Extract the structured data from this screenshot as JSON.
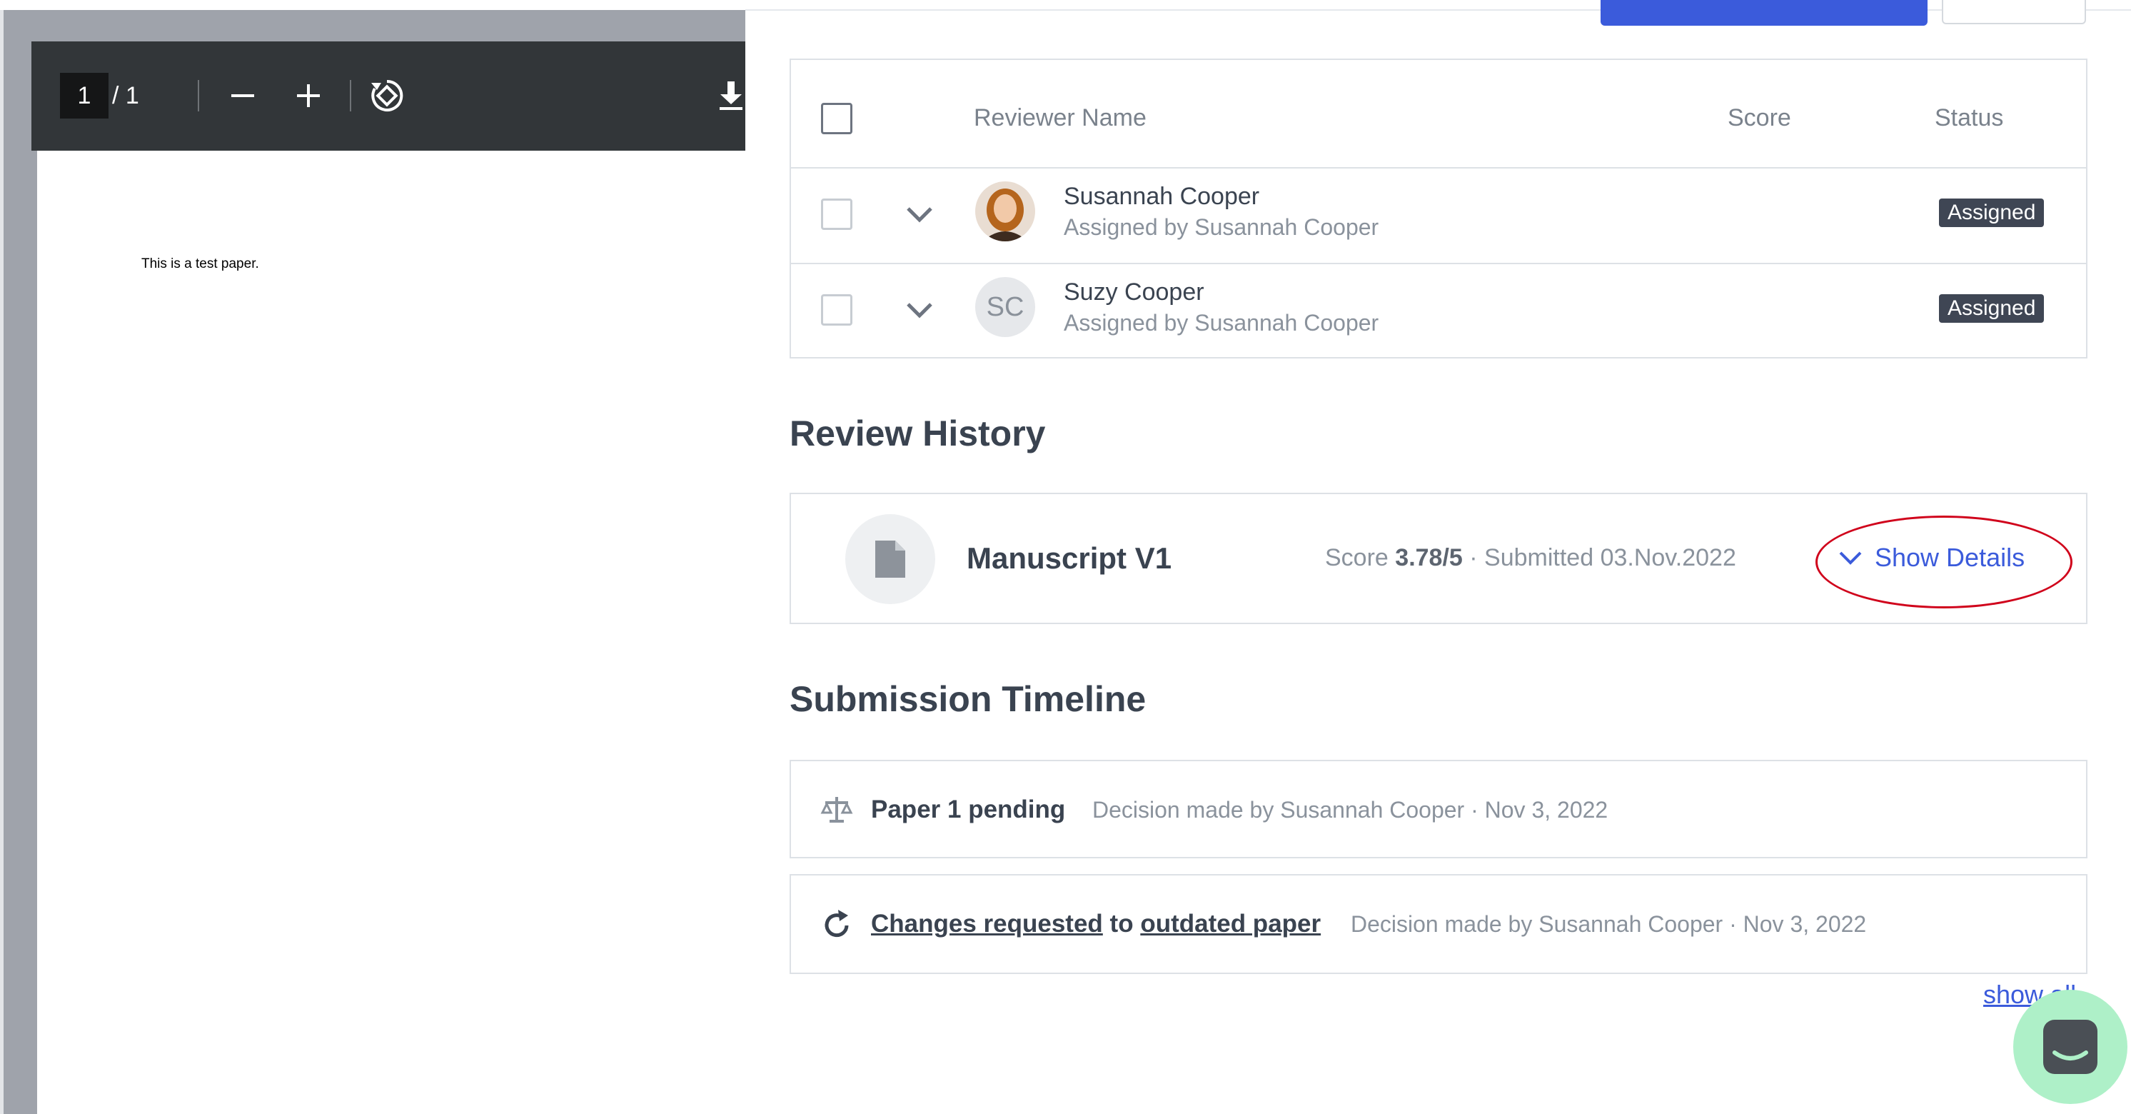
{
  "pdf_viewer": {
    "current_page": "1",
    "page_total": "/  1",
    "paper_text": "This is a test paper.",
    "icons": [
      "zoom-out-icon",
      "zoom-in-icon",
      "rotate-icon",
      "download-icon"
    ]
  },
  "reviewers": {
    "headers": {
      "name": "Reviewer Name",
      "score": "Score",
      "status": "Status"
    },
    "rows": [
      {
        "name": "Susannah Cooper",
        "assigned_by": "Assigned by Susannah Cooper",
        "status": "Assigned",
        "avatar": "photo"
      },
      {
        "name": "Suzy Cooper",
        "assigned_by": "Assigned by Susannah Cooper",
        "status": "Assigned",
        "avatar_initials": "SC"
      }
    ]
  },
  "review_history": {
    "title": "Review History",
    "item": {
      "name": "Manuscript V1",
      "score_label": "Score",
      "score_value": "3.78/5",
      "submitted": "· Submitted 03.Nov.2022",
      "action": "Show Details"
    }
  },
  "timeline": {
    "title": "Submission Timeline",
    "items": [
      {
        "text": "Paper 1 pending",
        "meta": "Decision made by Susannah Cooper · Nov 3, 2022",
        "icon": "scale-icon"
      },
      {
        "link1": "Changes requested",
        "mid": "to",
        "link2": "outdated paper",
        "meta": "Decision made by Susannah Cooper · Nov 3, 2022",
        "icon": "refresh-icon"
      }
    ],
    "show_all": "show all"
  },
  "colors": {
    "accent": "#3b5bdb",
    "badge": "#3f4654",
    "highlight": "#d0021b",
    "chat": "#aef0c8"
  }
}
